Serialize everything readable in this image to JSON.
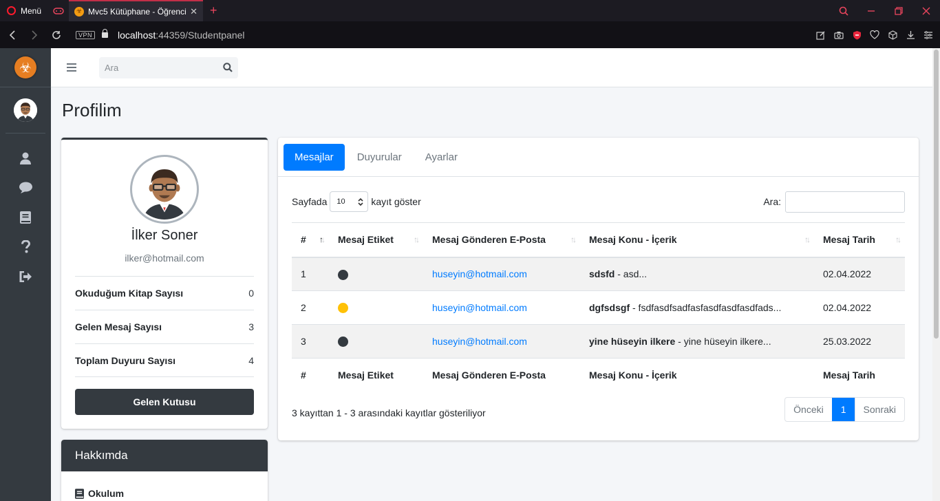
{
  "browser": {
    "menu_label": "Menü",
    "tab_title": "Mvc5 Kütüphane - Öğrenci",
    "vpn_label": "VPN",
    "url_host": "localhost",
    "url_rest": ":44359/Studentpanel"
  },
  "header": {
    "search_placeholder": "Ara"
  },
  "page": {
    "title": "Profilim"
  },
  "profile": {
    "name": "İlker Soner",
    "email": "ilker@hotmail.com",
    "stats": [
      {
        "label": "Okuduğum Kitap Sayısı",
        "value": "0"
      },
      {
        "label": "Gelen Mesaj Sayısı",
        "value": "3"
      },
      {
        "label": "Toplam Duyuru Sayısı",
        "value": "4"
      }
    ],
    "inbox_button": "Gelen Kutusu"
  },
  "about": {
    "title": "Hakkımda",
    "school_label": "Okulum"
  },
  "tabs": [
    {
      "label": "Mesajlar",
      "active": true
    },
    {
      "label": "Duyurular",
      "active": false
    },
    {
      "label": "Ayarlar",
      "active": false
    }
  ],
  "datatable": {
    "length_prefix": "Sayfada",
    "length_value": "10",
    "length_suffix": "kayıt göster",
    "search_label": "Ara:",
    "columns": [
      "#",
      "Mesaj Etiket",
      "Mesaj Gönderen E-Posta",
      "Mesaj Konu - İçerik",
      "Mesaj Tarih"
    ],
    "rows": [
      {
        "no": "1",
        "tag_color": "#343a40",
        "email": "huseyin@hotmail.com",
        "subject": "sdsfd",
        "content": " - asd...",
        "date": "02.04.2022"
      },
      {
        "no": "2",
        "tag_color": "#ffc107",
        "email": "huseyin@hotmail.com",
        "subject": "dgfsdsgf",
        "content": " - fsdfasdfsadfasfasdfasdfasdfads...",
        "date": "02.04.2022"
      },
      {
        "no": "3",
        "tag_color": "#343a40",
        "email": "huseyin@hotmail.com",
        "subject": "yine hüseyin ilkere",
        "content": " - yine hüseyin ilkere...",
        "date": "25.03.2022"
      }
    ],
    "info": "3 kayıttan 1 - 3 arasındaki kayıtlar gösteriliyor",
    "pager": {
      "prev": "Önceki",
      "current": "1",
      "next": "Sonraki"
    }
  },
  "colors": {
    "sidebar": "#343a40",
    "primary": "#007bff",
    "brand_logo": "#e67e22"
  }
}
